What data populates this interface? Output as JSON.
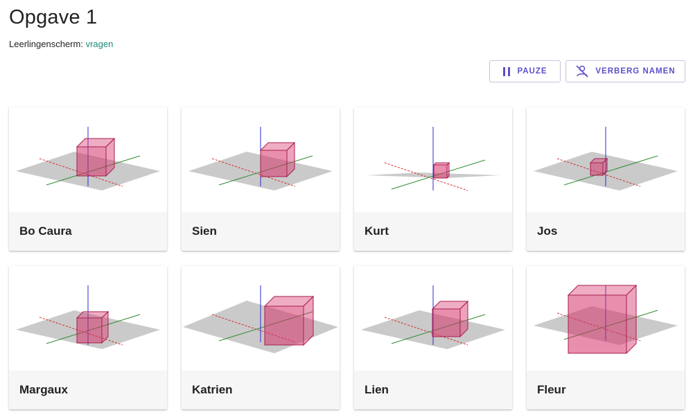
{
  "page": {
    "title": "Opgave 1",
    "subtitle_label": "Leerlingenscherm:",
    "subtitle_link": "vragen"
  },
  "toolbar": {
    "pause_label": "PAUZE",
    "hide_names_label": "VERBERG NAMEN",
    "pause_icon": "pause-icon",
    "hide_names_icon": "person-off-icon"
  },
  "colors": {
    "accent": "#5b4fc9",
    "link": "#1a8a7a",
    "cube_fill": "#d6336c",
    "cube_edge": "#a81e4e",
    "plane": "#8a8a8a",
    "axis_x": "#d62a2a",
    "axis_y": "#2e8b2e",
    "axis_z": "#2a2ad6"
  },
  "students": [
    {
      "name": "Bo Caura",
      "thumbnail": "3d-cube-graph"
    },
    {
      "name": "Sien",
      "thumbnail": "3d-cube-graph"
    },
    {
      "name": "Kurt",
      "thumbnail": "3d-cube-graph"
    },
    {
      "name": "Jos",
      "thumbnail": "3d-cube-graph"
    },
    {
      "name": "Margaux",
      "thumbnail": "3d-cube-graph"
    },
    {
      "name": "Katrien",
      "thumbnail": "3d-cube-graph"
    },
    {
      "name": "Lien",
      "thumbnail": "3d-cube-graph"
    },
    {
      "name": "Fleur",
      "thumbnail": "3d-cube-graph"
    }
  ]
}
